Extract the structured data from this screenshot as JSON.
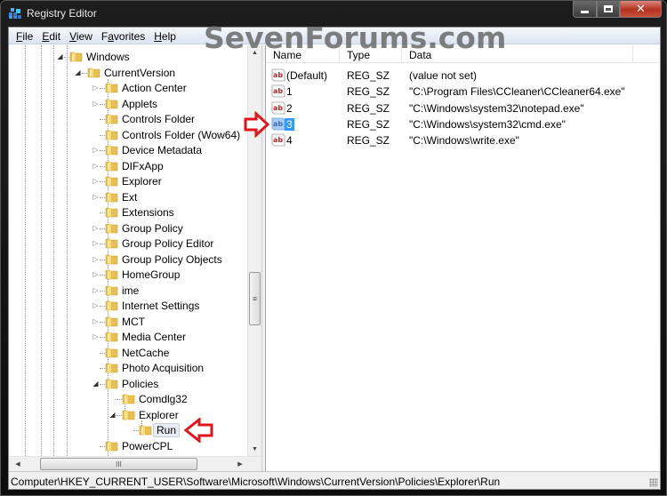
{
  "window": {
    "title": "Registry Editor",
    "buttons": {
      "minimize": "minimize",
      "maximize": "maximize",
      "close": "close"
    }
  },
  "menu": [
    {
      "label": "File",
      "accel": "F",
      "rest": "ile"
    },
    {
      "label": "Edit",
      "accel": "E",
      "rest": "dit"
    },
    {
      "label": "View",
      "accel": "V",
      "rest": "iew"
    },
    {
      "label": "Favorites",
      "accel_pre": "F",
      "accel": "a",
      "rest": "vorites"
    },
    {
      "label": "Help",
      "accel": "H",
      "rest": "elp"
    }
  ],
  "watermark": "SevenForums.com",
  "tree": {
    "items": [
      {
        "label": "Windows",
        "level": 0,
        "expander": "open"
      },
      {
        "label": "CurrentVersion",
        "level": 1,
        "expander": "open"
      },
      {
        "label": "Action Center",
        "level": 2,
        "expander": "closed"
      },
      {
        "label": "Applets",
        "level": 2,
        "expander": "closed"
      },
      {
        "label": "Controls Folder",
        "level": 2,
        "expander": "none"
      },
      {
        "label": "Controls Folder (Wow64)",
        "level": 2,
        "expander": "none"
      },
      {
        "label": "Device Metadata",
        "level": 2,
        "expander": "closed"
      },
      {
        "label": "DIFxApp",
        "level": 2,
        "expander": "closed"
      },
      {
        "label": "Explorer",
        "level": 2,
        "expander": "closed"
      },
      {
        "label": "Ext",
        "level": 2,
        "expander": "closed"
      },
      {
        "label": "Extensions",
        "level": 2,
        "expander": "none"
      },
      {
        "label": "Group Policy",
        "level": 2,
        "expander": "closed"
      },
      {
        "label": "Group Policy Editor",
        "level": 2,
        "expander": "closed"
      },
      {
        "label": "Group Policy Objects",
        "level": 2,
        "expander": "closed"
      },
      {
        "label": "HomeGroup",
        "level": 2,
        "expander": "closed"
      },
      {
        "label": "ime",
        "level": 2,
        "expander": "closed"
      },
      {
        "label": "Internet Settings",
        "level": 2,
        "expander": "closed"
      },
      {
        "label": "MCT",
        "level": 2,
        "expander": "closed"
      },
      {
        "label": "Media Center",
        "level": 2,
        "expander": "closed"
      },
      {
        "label": "NetCache",
        "level": 2,
        "expander": "none"
      },
      {
        "label": "Photo Acquisition",
        "level": 2,
        "expander": "none"
      },
      {
        "label": "Policies",
        "level": 2,
        "expander": "open"
      },
      {
        "label": "Comdlg32",
        "level": 3,
        "expander": "none"
      },
      {
        "label": "Explorer",
        "level": 3,
        "expander": "open"
      },
      {
        "label": "Run",
        "level": 4,
        "expander": "none",
        "selected": true
      },
      {
        "label": "PowerCPL",
        "level": 2,
        "expander": "none"
      }
    ],
    "scrollbar_thumb_glyph": "≡",
    "hscroll_thumb_glyph": "III"
  },
  "list": {
    "columns": [
      "Name",
      "Type",
      "Data"
    ],
    "rows": [
      {
        "name": "(Default)",
        "type": "REG_SZ",
        "data": "(value not set)",
        "selected": false
      },
      {
        "name": "1",
        "type": "REG_SZ",
        "data": "\"C:\\Program Files\\CCleaner\\CCleaner64.exe\"",
        "selected": false
      },
      {
        "name": "2",
        "type": "REG_SZ",
        "data": "\"C:\\Windows\\system32\\notepad.exe\"",
        "selected": false
      },
      {
        "name": "3",
        "type": "REG_SZ",
        "data": "\"C:\\Windows\\system32\\cmd.exe\"",
        "selected": true
      },
      {
        "name": "4",
        "type": "REG_SZ",
        "data": "\"C:\\Windows\\write.exe\"",
        "selected": false
      }
    ]
  },
  "statusbar": {
    "path": "Computer\\HKEY_CURRENT_USER\\Software\\Microsoft\\Windows\\CurrentVersion\\Policies\\Explorer\\Run"
  },
  "colors": {
    "selection": "#3399ff",
    "annotation_arrow": "#e0161c",
    "folder": "#f1cf63"
  }
}
